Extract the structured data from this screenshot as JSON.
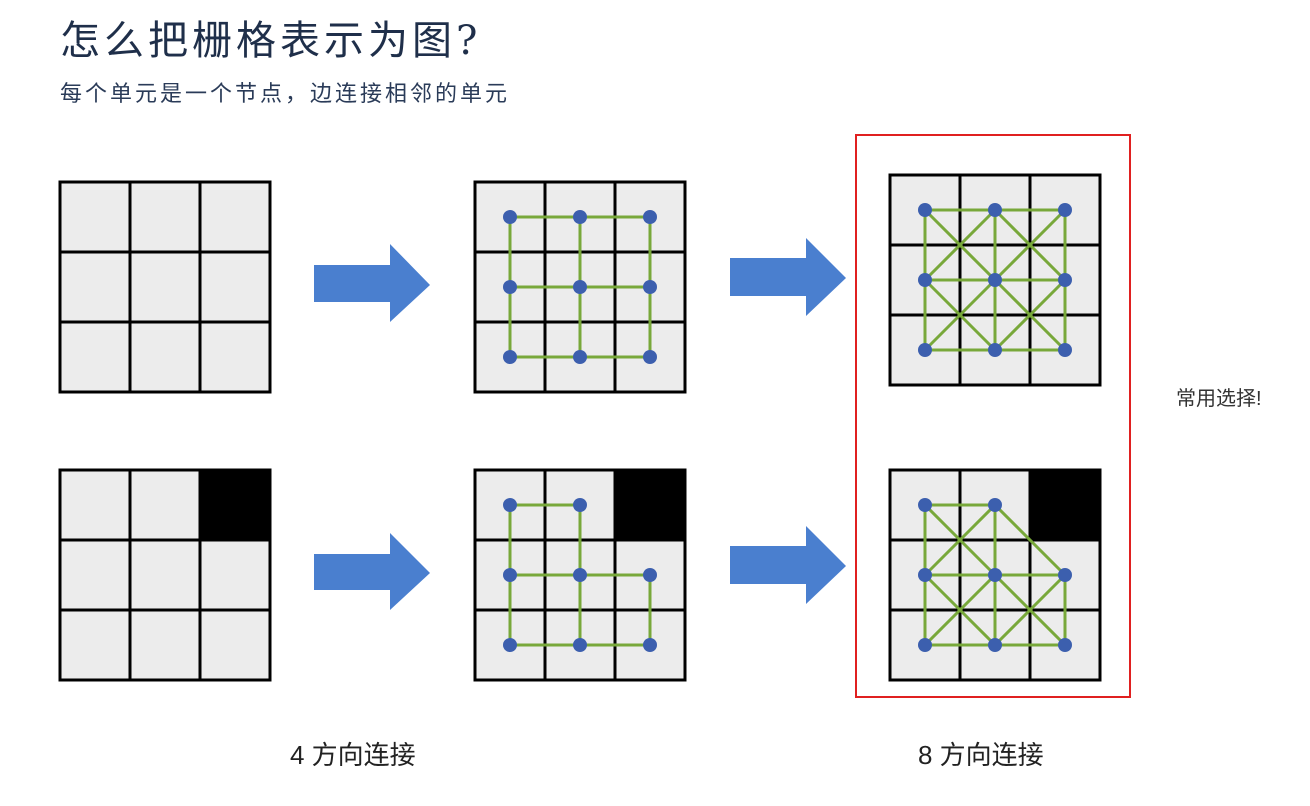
{
  "title": "怎么把栅格表示为图?",
  "subtitle": "每个单元是一个节点，边连接相邻的单元",
  "note": "常用选择!",
  "captions": {
    "four": "4 方向连接",
    "eight": "8 方向连接"
  },
  "colors": {
    "cell_fill": "#ececec",
    "blocked_fill": "#000000",
    "grid_line": "#000000",
    "edge": "#78a83a",
    "node": "#3c5fae",
    "arrow": "#4a7fcf",
    "highlight": "#e02020"
  },
  "grids": [
    {
      "id": "plain-top",
      "blocked": [],
      "edges": "none"
    },
    {
      "id": "four-top",
      "blocked": [],
      "edges": "4"
    },
    {
      "id": "eight-top",
      "blocked": [],
      "edges": "8"
    },
    {
      "id": "plain-bottom",
      "blocked": [
        [
          0,
          2
        ]
      ],
      "edges": "none"
    },
    {
      "id": "four-bottom",
      "blocked": [
        [
          0,
          2
        ]
      ],
      "edges": "4"
    },
    {
      "id": "eight-bottom",
      "blocked": [
        [
          0,
          2
        ]
      ],
      "edges": "8"
    }
  ]
}
